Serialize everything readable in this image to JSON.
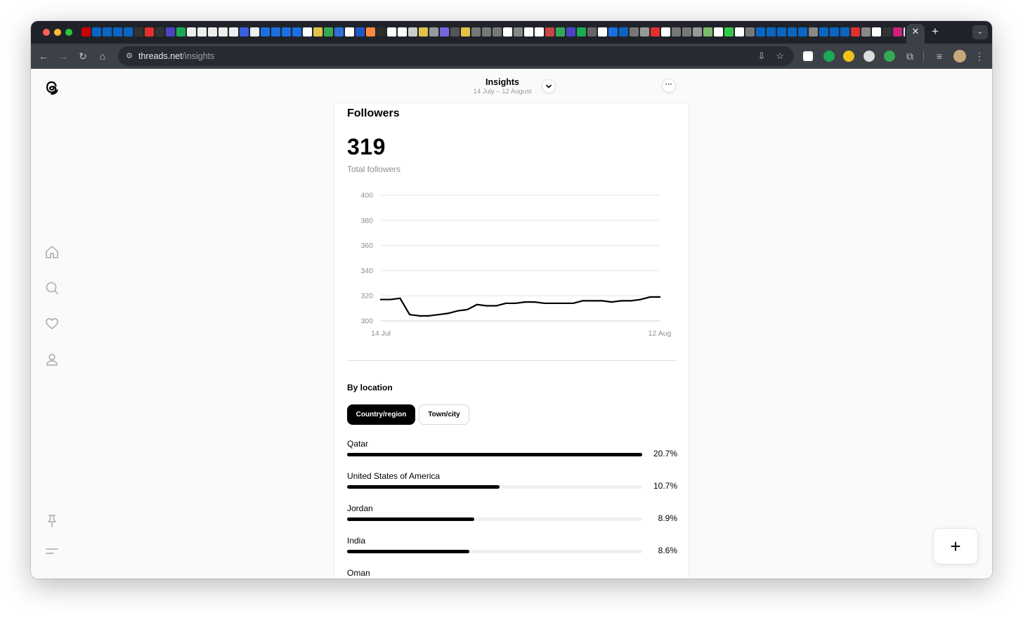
{
  "browser": {
    "url_host": "threads.net",
    "url_path": "/insights",
    "favicon_colors": [
      "#cc0000",
      "#0a66c2",
      "#0a66c2",
      "#0a66c2",
      "#0a66c2",
      "#333333",
      "#e03030",
      "#333333",
      "#4b44c5",
      "#1aaa55",
      "#eeeeee",
      "#eeeeee",
      "#eeeeee",
      "#eeeeee",
      "#eeeeee",
      "#3b5ee0",
      "#eeeeee",
      "#1c6fe0",
      "#1c6fe0",
      "#1c6fe0",
      "#1c6fe0",
      "#ffffff",
      "#e0c14a",
      "#35a853",
      "#2f6fd6",
      "#ffffff",
      "#2156c5",
      "#ff8a3d",
      "#2c2c2c",
      "#ffffff",
      "#ffffff",
      "#cccccc",
      "#e0c14a",
      "#999999",
      "#7766dd",
      "#555555",
      "#e0c14a",
      "#777777",
      "#777777",
      "#777777",
      "#ffffff",
      "#888888",
      "#ffffff",
      "#ffffff",
      "#cc4444",
      "#35a853",
      "#4b44c5",
      "#1aaa55",
      "#666666",
      "#ffffff",
      "#1c6fe0",
      "#0a66c2",
      "#777777",
      "#999999",
      "#e03030",
      "#ffffff",
      "#777777",
      "#777777",
      "#999999",
      "#7dbb6a",
      "#ffffff",
      "#35c84a",
      "#ffffff",
      "#777777",
      "#0a66c2",
      "#0a66c2",
      "#0a66c2",
      "#0a66c2",
      "#0a66c2",
      "#888888",
      "#0a66c2",
      "#0a66c2",
      "#0a66c2",
      "#e03030",
      "#888888",
      "#ffffff",
      "#333333",
      "#cc2277",
      "#e8eaed",
      "#35a853",
      "#e8eaed",
      "#e34133",
      "#0a66c2",
      "#0a66c2"
    ],
    "extension_colors": [
      "#ffffff",
      "#1aaa55",
      "#f0c21b",
      "#dddddd",
      "#35a853",
      "#c4c7cc"
    ]
  },
  "header": {
    "title": "Insights",
    "date_range": "14 July – 12 August",
    "more_label": "···"
  },
  "followers": {
    "section_title": "Followers",
    "total": "319",
    "total_label": "Total followers"
  },
  "chart_data": {
    "type": "line",
    "title": "",
    "xlabel": "",
    "ylabel": "",
    "x_ticks": [
      "14 Jul",
      "12 Aug"
    ],
    "y_ticks": [
      300,
      320,
      340,
      360,
      380,
      400
    ],
    "ylim": [
      300,
      400
    ],
    "grid": true,
    "series": [
      {
        "x": [
          "14 Jul",
          "15 Jul",
          "16 Jul",
          "17 Jul",
          "18 Jul",
          "19 Jul",
          "20 Jul",
          "21 Jul",
          "22 Jul",
          "23 Jul",
          "24 Jul",
          "25 Jul",
          "26 Jul",
          "27 Jul",
          "28 Jul",
          "29 Jul",
          "30 Jul",
          "31 Jul",
          "1 Aug",
          "2 Aug",
          "3 Aug",
          "4 Aug",
          "5 Aug",
          "6 Aug",
          "7 Aug",
          "8 Aug",
          "9 Aug",
          "10 Aug",
          "11 Aug",
          "12 Aug"
        ],
        "values": [
          317,
          317,
          318,
          305,
          304,
          304,
          305,
          306,
          308,
          309,
          313,
          312,
          312,
          314,
          314,
          315,
          315,
          314,
          314,
          314,
          314,
          316,
          316,
          316,
          315,
          316,
          316,
          317,
          319,
          319
        ]
      }
    ]
  },
  "location": {
    "title": "By location",
    "tab_country": "Country/region",
    "tab_town": "Town/city",
    "rows": [
      {
        "name": "Qatar",
        "percent": 20.7,
        "label": "20.7%"
      },
      {
        "name": "United States of America",
        "percent": 10.7,
        "label": "10.7%"
      },
      {
        "name": "Jordan",
        "percent": 8.9,
        "label": "8.9%"
      },
      {
        "name": "India",
        "percent": 8.6,
        "label": "8.6%"
      },
      {
        "name": "Oman",
        "percent": null,
        "label": ""
      }
    ]
  },
  "fab_label": "+"
}
